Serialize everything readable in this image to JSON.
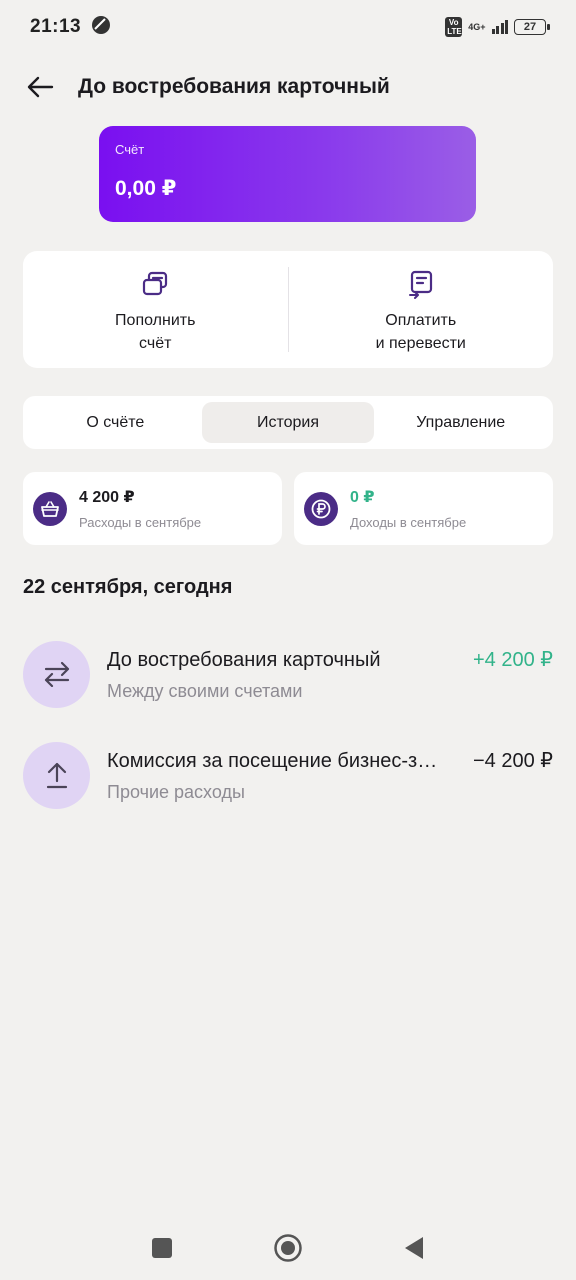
{
  "status_bar": {
    "time": "21:13",
    "volte": "Vo LTE",
    "network": "4G+",
    "battery": "27"
  },
  "header": {
    "title": "До востребования карточный"
  },
  "account_card": {
    "label": "Счёт",
    "amount": "0,00 ₽",
    "gradient_start": "#7a0ff0",
    "gradient_end": "#9a5ee6"
  },
  "actions": [
    {
      "label": "Пополнить\nсчёт",
      "icon": "cards-stack-icon"
    },
    {
      "label": "Оплатить\nи перевести",
      "icon": "document-transfer-icon"
    }
  ],
  "tabs": [
    {
      "label": "О счёте",
      "active": false
    },
    {
      "label": "История",
      "active": true
    },
    {
      "label": "Управление",
      "active": false
    }
  ],
  "summary": {
    "expenses": {
      "amount": "4 200 ₽",
      "caption": "Расходы в сентябре",
      "icon": "basket-icon"
    },
    "income": {
      "amount": "0 ₽",
      "caption": "Доходы в сентябре",
      "icon": "ruble-icon"
    }
  },
  "date_header": "22 сентября, сегодня",
  "transactions": [
    {
      "title": "До востребования карточный",
      "subtitle": "Между своими счетами",
      "amount": "+4 200 ₽",
      "icon": "transfer-arrows-icon",
      "positive": true
    },
    {
      "title": "Комиссия за посещение бизнес-зала",
      "subtitle": "Прочие расходы",
      "amount": "−4 200 ₽",
      "icon": "arrow-up-icon",
      "positive": false
    }
  ],
  "colors": {
    "accent": "#7a0ff0",
    "positive": "#32b38a",
    "icon_dark": "#4b2c86",
    "icon_bg": "#e0d4f4"
  }
}
